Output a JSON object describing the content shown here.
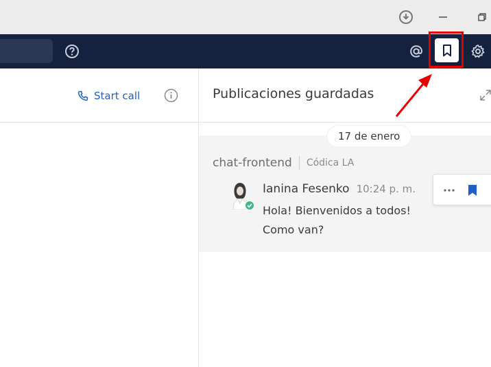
{
  "header": {
    "help_icon": "question-circle-icon",
    "mentions_icon": "at-icon",
    "saved_icon": "bookmark-icon",
    "settings_icon": "gear-icon"
  },
  "channel": {
    "start_call_label": "Start call"
  },
  "saved_panel": {
    "title": "Publicaciones guardadas",
    "date_separator": "17 de enero",
    "post": {
      "channel": "chat-frontend",
      "team": "Códica LA",
      "author": "Ianina Fesenko",
      "time": "10:24 p. m.",
      "message": "Hola! Bienvenidos a todos! Como van?"
    }
  },
  "colors": {
    "topbar": "#15223f",
    "accent": "#1f5fc6",
    "online": "#3db887",
    "highlight": "#e60000"
  }
}
